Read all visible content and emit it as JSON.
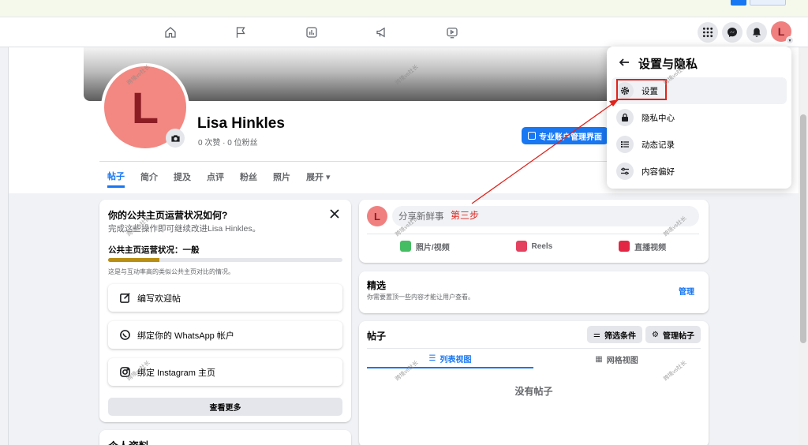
{
  "profile": {
    "avatar_letter": "L",
    "name": "Lisa Hinkles",
    "stats": "0 次赞 · 0 位粉丝",
    "pro_button": "专业账户管理界面"
  },
  "tabs": [
    "帖子",
    "简介",
    "提及",
    "点评",
    "粉丝",
    "照片",
    "展开 ▾"
  ],
  "health": {
    "title": "你的公共主页运营状况如何?",
    "subtitle": "完成这些操作即可继续改进Lisa Hinkles。",
    "status_label": "公共主页运营状况：一般",
    "progress": 0.22,
    "note": "这是与互动率高的类似公共主页对比的情况。",
    "actions": [
      "编写欢迎帖",
      "绑定你的 WhatsApp 帐户",
      "绑定 Instagram 主页"
    ],
    "see_more": "查看更多"
  },
  "personal_info_heading": "个人资料",
  "composer": {
    "avatar_letter": "L",
    "placeholder": "分享新鲜事",
    "media": [
      "照片/视频",
      "Reels",
      "直播视频"
    ]
  },
  "featured": {
    "title": "精选",
    "subtitle": "你需要置顶一些内容才能让用户查看。",
    "manage": "管理"
  },
  "posts": {
    "title": "帖子",
    "filter": "筛选条件",
    "manage": "管理帖子",
    "list_view": "列表视图",
    "grid_view": "网格视图",
    "empty": "没有帖子"
  },
  "menu": {
    "title": "设置与隐私",
    "items": [
      "设置",
      "隐私中心",
      "动态记录",
      "内容偏好"
    ]
  },
  "account_avatar_letter": "L",
  "annotation": "第三步",
  "watermark": "跨境vs社长",
  "colors": {
    "accent": "#1877f2",
    "annotation": "#e0231c",
    "avatar": "#f28881"
  }
}
